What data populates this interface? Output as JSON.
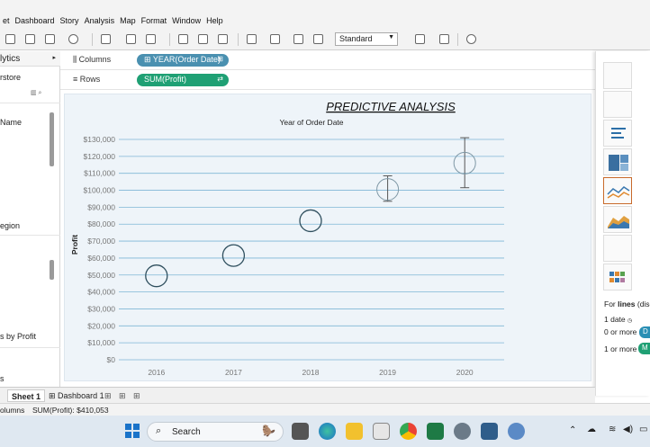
{
  "app": {
    "menu": [
      "et",
      "Dashboard",
      "Story",
      "Analysis",
      "Map",
      "Format",
      "Window",
      "Help"
    ]
  },
  "toolbar": {
    "fit_dropdown": "Standard"
  },
  "left_pane": {
    "header": "lytics",
    "datasource": "rstore",
    "items": [
      "Name",
      "egion",
      "s by Profit",
      "s"
    ]
  },
  "shelves": {
    "columns_label": "Columns",
    "rows_label": "Rows",
    "columns_pill": "YEAR(Order Date)",
    "rows_pill": "SUM(Profit)"
  },
  "colors": {
    "columns_pill": "#4a90b0",
    "rows_pill": "#1fa074",
    "circle_stroke": "#2f4f5e",
    "gridline": "#7fb6d6",
    "errorbar": "#555555",
    "highlight_chip": "#2a8fb4",
    "measure_chip": "#1fa074"
  },
  "chart_data": {
    "type": "scatter",
    "title": "PREDICTIVE ANALYSIS",
    "xlabel": "Year of Order Date",
    "ylabel": "Profit",
    "categories": [
      "2016",
      "2017",
      "2018",
      "2019",
      "2020"
    ],
    "values": [
      49500,
      61500,
      82000,
      100500,
      116000
    ],
    "forecast": [
      false,
      false,
      false,
      true,
      true
    ],
    "error_low": [
      null,
      null,
      null,
      93500,
      101500
    ],
    "error_high": [
      null,
      null,
      null,
      108500,
      131000
    ],
    "ylim": [
      0,
      130000
    ],
    "yticks": [
      0,
      10000,
      20000,
      30000,
      40000,
      50000,
      60000,
      70000,
      80000,
      90000,
      100000,
      110000,
      120000,
      130000
    ],
    "ytick_labels": [
      "$0",
      "$10,000",
      "$20,000",
      "$30,000",
      "$40,000",
      "$50,000",
      "$60,000",
      "$70,000",
      "$80,000",
      "$90,000",
      "$100,000",
      "$110,000",
      "$120,000",
      "$130,000"
    ],
    "grid": true
  },
  "right_pane": {
    "for_lines_prefix": "For ",
    "for_lines_bold": "lines",
    "for_lines_suffix": " (disc",
    "req1": "1 date",
    "req2": "0 or more",
    "req3": "1 or more",
    "chip2": "D",
    "chip3": "M"
  },
  "sheet_tabs": [
    "Sheet 1",
    "Dashboard 1"
  ],
  "status": {
    "left": "olumns",
    "sum": "SUM(Profit): $410,053"
  },
  "taskbar": {
    "search": "Search"
  }
}
